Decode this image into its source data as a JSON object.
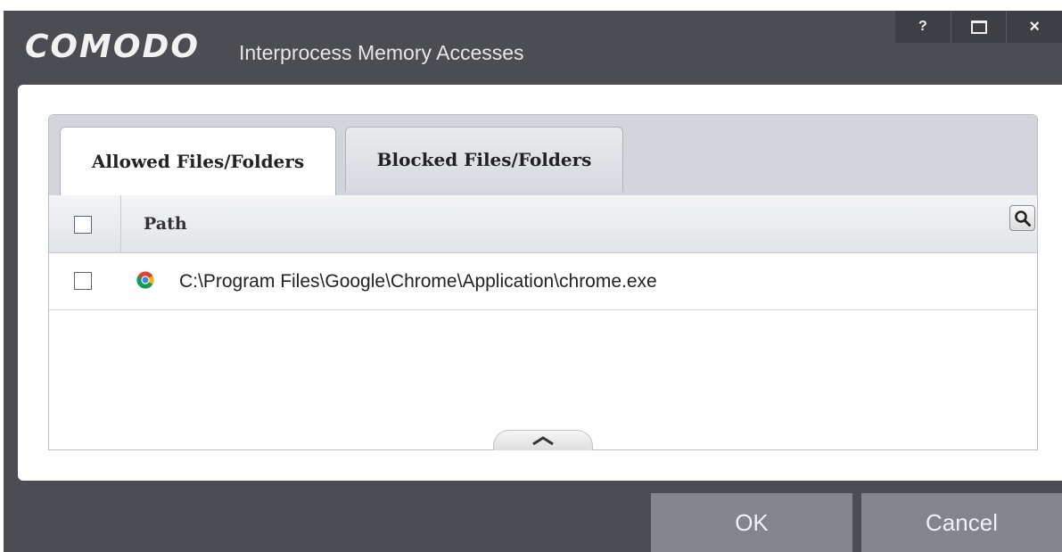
{
  "window": {
    "brand": "COMODO",
    "title": "Interprocess Memory Accesses",
    "buttons": {
      "help": "?",
      "close": "×"
    }
  },
  "tabs": [
    {
      "label": "Allowed Files/Folders",
      "active": true
    },
    {
      "label": "Blocked Files/Folders",
      "active": false
    }
  ],
  "table": {
    "header": {
      "path_label": "Path"
    },
    "rows": [
      {
        "icon": "chrome-icon",
        "path": "C:\\Program Files\\Google\\Chrome\\Application\\chrome.exe",
        "checked": false
      }
    ]
  },
  "footer": {
    "ok_label": "OK",
    "cancel_label": "Cancel"
  },
  "colors": {
    "window_bg": "#4b4d53",
    "tabbar_bg": "#d2d6dc",
    "button_bg": "#82868c"
  }
}
